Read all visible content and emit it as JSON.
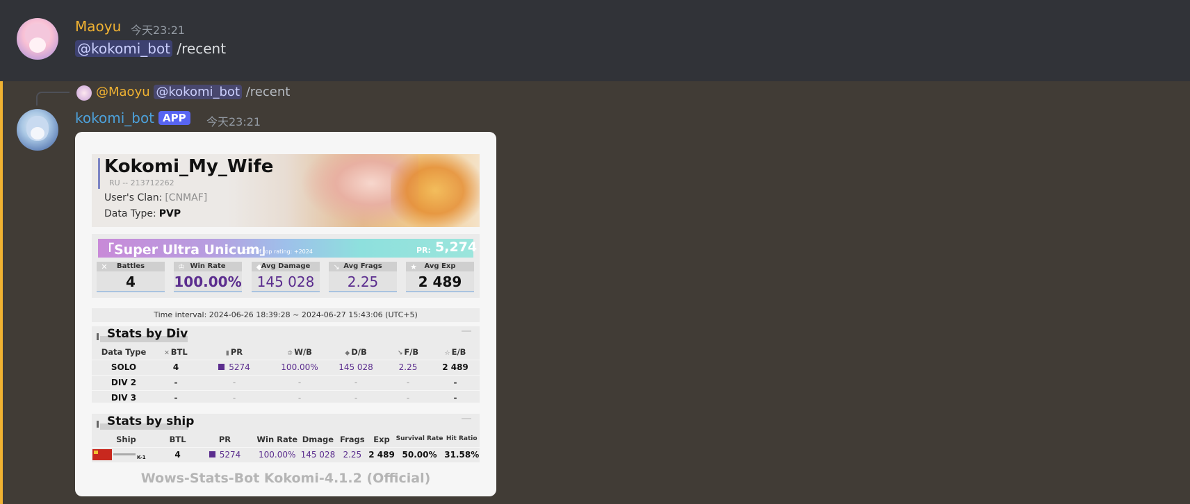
{
  "message1": {
    "username": "Maoyu",
    "timestamp": "今天23:21",
    "mention": "@kokomi_bot",
    "command": " /recent"
  },
  "message2": {
    "reply": {
      "author": "@Maoyu",
      "mention": "@kokomi_bot",
      "command": " /recent"
    },
    "username": "kokomi_bot",
    "badge": "APP",
    "timestamp": "今天23:21"
  },
  "card": {
    "player": {
      "name": "Kokomi_My_Wife",
      "id": "RU -- 213712262",
      "clan_label": "User's Clan:",
      "clan": "[CNMAF]",
      "type_label": "Data Type:",
      "type": "PVP"
    },
    "rating": {
      "title": "「Super Ultra Unicum」",
      "sub": "Out of top rating:  +2024",
      "pr_label": "PR:",
      "pr": "5,274"
    },
    "stats": [
      {
        "label": "Battles",
        "value": "4",
        "icon": "battles-icon"
      },
      {
        "label": "Win Rate",
        "value": "100.00%",
        "icon": "trophy-icon"
      },
      {
        "label": "Avg Damage",
        "value": "145 028",
        "icon": "damage-icon"
      },
      {
        "label": "Avg Frags",
        "value": "2.25",
        "icon": "frags-icon"
      },
      {
        "label": "Avg Exp",
        "value": "2 489",
        "icon": "star-icon"
      }
    ],
    "interval": "Time interval:  2024-06-26 18:39:28 ~ 2024-06-27 15:43:06  (UTC+5)",
    "div_section": {
      "title": "Stats by Div",
      "headers": [
        "Data Type",
        "BTL",
        "PR",
        "W/B",
        "D/B",
        "F/B",
        "E/B"
      ],
      "rows": [
        [
          "SOLO",
          "4",
          "5274",
          "100.00%",
          "145 028",
          "2.25",
          "2 489"
        ],
        [
          "DIV 2",
          "-",
          "-",
          "-",
          "-",
          "-",
          "-"
        ],
        [
          "DIV 3",
          "-",
          "-",
          "-",
          "-",
          "-",
          "-"
        ]
      ]
    },
    "ship_section": {
      "title": "Stats by ship",
      "headers": [
        "Ship",
        "BTL",
        "PR",
        "Win Rate",
        "Dmage",
        "Frags",
        "Exp",
        "Survival Rate",
        "Hit Ratio"
      ],
      "rows": [
        [
          "K-1",
          "4",
          "5274",
          "100.00%",
          "145 028",
          "2.25",
          "2 489",
          "50.00%",
          "31.58%"
        ]
      ]
    },
    "footer": "Wows-Stats-Bot Kokomi-4.1.2 (Official)"
  },
  "colors": {
    "maoyu_name": "#f0b232",
    "bot_name": "#4da0d9",
    "app_badge": "#5865f2",
    "highlight_bar": "#f0b232",
    "pr_purple": "#5b2d8e"
  }
}
